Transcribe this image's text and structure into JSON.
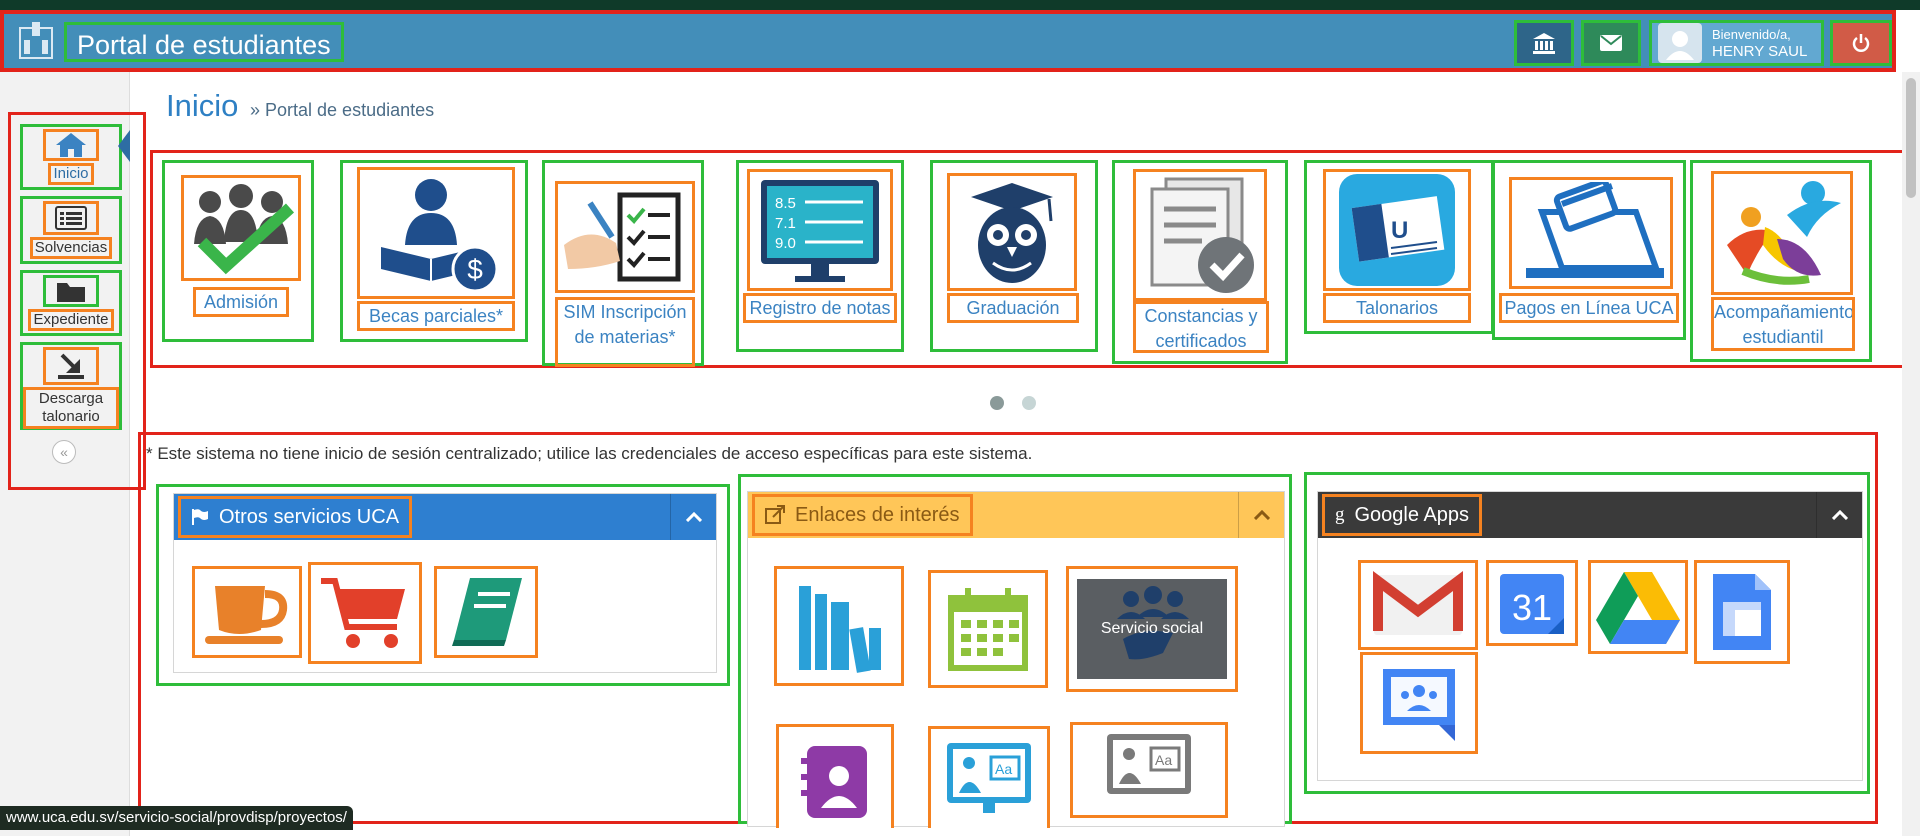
{
  "header": {
    "title": "Portal de estudiantes",
    "welcome_line1": "Bienvenido/a,",
    "welcome_line2": "HENRY SAUL"
  },
  "sidebar": {
    "items": [
      {
        "label": "Inicio",
        "icon": "home-icon"
      },
      {
        "label": "Solvencias",
        "icon": "list-icon"
      },
      {
        "label": "Expediente",
        "icon": "folder-icon"
      },
      {
        "label": "Descarga talonario",
        "icon": "download-icon"
      }
    ]
  },
  "page": {
    "title": "Inicio",
    "breadcrumb": "» Portal de estudiantes"
  },
  "carousel": {
    "tiles": [
      {
        "label": "Admisión",
        "icon": "admission-icon"
      },
      {
        "label": "Becas parciales*",
        "icon": "scholarship-icon"
      },
      {
        "label": "SIM Inscripción de materias*",
        "icon": "enrollment-icon"
      },
      {
        "label": "Registro de notas",
        "icon": "grades-icon"
      },
      {
        "label": "Graduación",
        "icon": "graduation-owl-icon"
      },
      {
        "label": "Constancias y certificados",
        "icon": "certificates-icon"
      },
      {
        "label": "Talonarios",
        "icon": "payment-slip-icon"
      },
      {
        "label": "Pagos en Línea UCA",
        "icon": "online-payment-icon"
      },
      {
        "label": "Acompañamiento estudiantil",
        "icon": "student-support-icon"
      }
    ],
    "active_page": 1,
    "total_pages": 2
  },
  "note": "* Este sistema no tiene inicio de sesión centralizado; utilice las credenciales de acceso específicas para este sistema.",
  "panels": {
    "otros": {
      "title": "Otros servicios UCA",
      "icon": "flag-icon",
      "color": "#2e7fd0"
    },
    "enlaces": {
      "title": "Enlaces de interés",
      "icon": "external-link-icon",
      "color": "#ffc658",
      "servicio_social": "Servicio social"
    },
    "google": {
      "title": "Google Apps",
      "icon": "google-icon",
      "color": "#3a3a3a"
    }
  },
  "status_url": "www.uca.edu.sv/servicio-social/provdisp/proyectos/"
}
